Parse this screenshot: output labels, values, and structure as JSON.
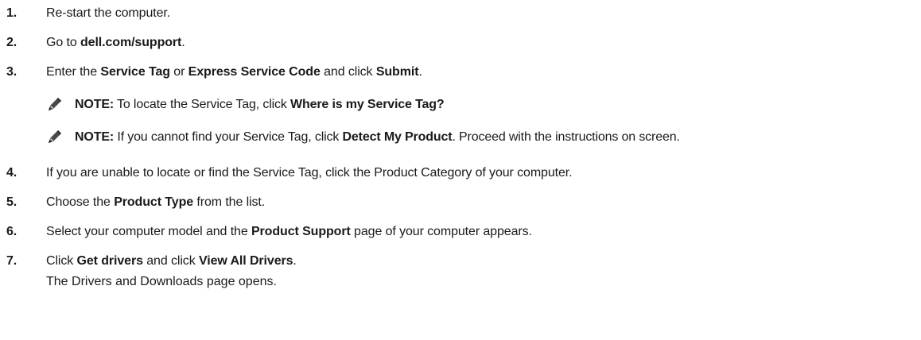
{
  "steps": [
    {
      "number": "1.",
      "parts": [
        {
          "t": "Re-start the computer.",
          "b": false
        }
      ]
    },
    {
      "number": "2.",
      "parts": [
        {
          "t": "Go to ",
          "b": false
        },
        {
          "t": "dell.com/support",
          "b": true
        },
        {
          "t": ".",
          "b": false
        }
      ]
    },
    {
      "number": "3.",
      "parts": [
        {
          "t": "Enter the ",
          "b": false
        },
        {
          "t": "Service Tag",
          "b": true
        },
        {
          "t": " or ",
          "b": false
        },
        {
          "t": "Express Service Code",
          "b": true
        },
        {
          "t": " and click ",
          "b": false
        },
        {
          "t": "Submit",
          "b": true
        },
        {
          "t": ".",
          "b": false
        }
      ]
    },
    {
      "number": "4.",
      "parts": [
        {
          "t": "If you are unable to locate or find the Service Tag, click the Product Category of your computer.",
          "b": false
        }
      ]
    },
    {
      "number": "5.",
      "parts": [
        {
          "t": "Choose the ",
          "b": false
        },
        {
          "t": "Product Type",
          "b": true
        },
        {
          "t": " from the list.",
          "b": false
        }
      ]
    },
    {
      "number": "6.",
      "parts": [
        {
          "t": "Select your computer model and the ",
          "b": false
        },
        {
          "t": "Product Support",
          "b": true
        },
        {
          "t": " page of your computer appears.",
          "b": false
        }
      ]
    },
    {
      "number": "7.",
      "parts": [
        {
          "t": "Click ",
          "b": false
        },
        {
          "t": "Get drivers",
          "b": true
        },
        {
          "t": " and click ",
          "b": false
        },
        {
          "t": "View All Drivers",
          "b": true
        },
        {
          "t": ".",
          "b": false
        }
      ]
    }
  ],
  "notes": [
    {
      "icon": "pencil-note-icon",
      "parts": [
        {
          "t": "NOTE:",
          "b": true
        },
        {
          "t": " To locate the Service Tag, click ",
          "b": false
        },
        {
          "t": "Where is my Service Tag?",
          "b": true
        }
      ]
    },
    {
      "icon": "pencil-note-icon",
      "parts": [
        {
          "t": "NOTE:",
          "b": true
        },
        {
          "t": " If you cannot find your Service Tag, click ",
          "b": false
        },
        {
          "t": "Detect My Product",
          "b": true
        },
        {
          "t": ". Proceed with the instructions on screen.",
          "b": false
        }
      ]
    }
  ],
  "step7_result": "The Drivers and Downloads page opens."
}
